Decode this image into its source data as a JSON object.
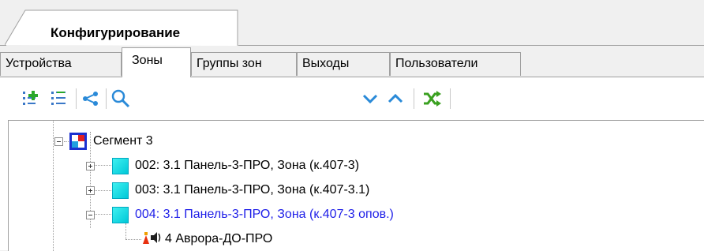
{
  "main_tab": {
    "label": "Конфигурирование"
  },
  "tabs": [
    {
      "label": "Устройства",
      "active": false
    },
    {
      "label": "Зоны",
      "active": true
    },
    {
      "label": "Группы зон",
      "active": false
    },
    {
      "label": "Выходы",
      "active": false
    },
    {
      "label": "Пользователи",
      "active": false
    }
  ],
  "toolbar": {
    "buttons": [
      {
        "icon": "add-zone-icon"
      },
      {
        "icon": "list-tree-icon"
      },
      {
        "icon": "link-icon"
      },
      {
        "icon": "search-icon"
      },
      {
        "icon": "chevron-down-icon"
      },
      {
        "icon": "chevron-up-icon"
      },
      {
        "icon": "shuffle-icon"
      }
    ]
  },
  "tree": {
    "segment": {
      "label": "Сегмент 3",
      "expanded": true
    },
    "zones": [
      {
        "label": "002: 3.1 Панель-3-ПРО, Зона (к.407-3)",
        "expanded": false,
        "selected": false
      },
      {
        "label": "003: 3.1 Панель-3-ПРО, Зона (к.407-3.1)",
        "expanded": false,
        "selected": false
      },
      {
        "label": "004: 3.1 Панель-3-ПРО, Зона (к.407-3 опов.)",
        "expanded": true,
        "selected": true
      }
    ],
    "device": {
      "label": "4 Аврора-ДО-ПРО",
      "icon": "siren-icon"
    }
  },
  "colors": {
    "selected_text": "#1e1ee8",
    "zone_icon": "#20e0e8",
    "toolbar_blue": "#2a8ad8",
    "toolbar_green": "#3aa020"
  }
}
